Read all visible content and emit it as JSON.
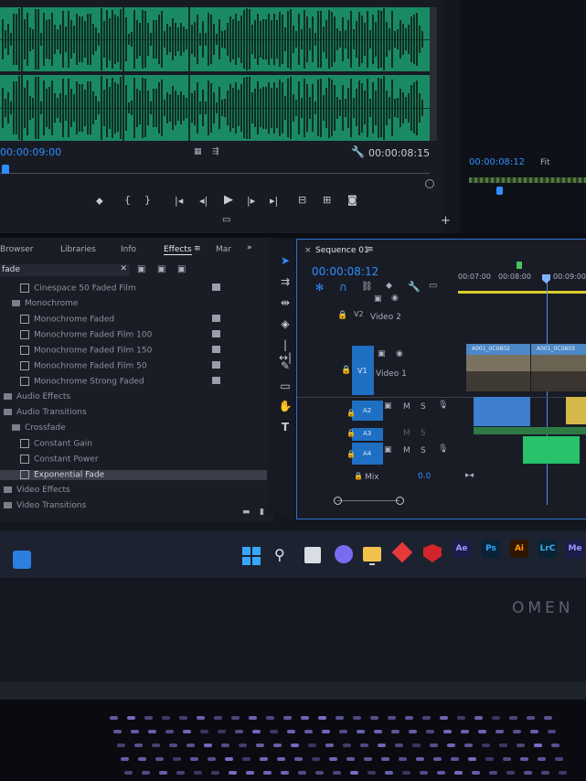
{
  "source_monitor": {
    "timecode_left": "00:00:09:00",
    "timecode_right": "00:00:08:15"
  },
  "program_monitor": {
    "timecode": "00:00:08:12",
    "fit_label": "Fit"
  },
  "effects_panel": {
    "tabs": [
      "Browser",
      "Libraries",
      "Info",
      "Effects",
      "Mar"
    ],
    "search_value": "fade",
    "tree": [
      {
        "label": "Cinespace 50 Faded Film",
        "kind": "preset",
        "level": 2
      },
      {
        "label": "Monochrome",
        "kind": "folder",
        "level": 1
      },
      {
        "label": "Monochrome Faded",
        "kind": "preset",
        "level": 2
      },
      {
        "label": "Monochrome Faded Film 100",
        "kind": "preset",
        "level": 2
      },
      {
        "label": "Monochrome Faded Film 150",
        "kind": "preset",
        "level": 2
      },
      {
        "label": "Monochrome Faded Film 50",
        "kind": "preset",
        "level": 2
      },
      {
        "label": "Monochrome Strong Faded",
        "kind": "preset",
        "level": 2
      },
      {
        "label": "Audio Effects",
        "kind": "folder",
        "level": 0
      },
      {
        "label": "Audio Transitions",
        "kind": "folder",
        "level": 0
      },
      {
        "label": "Crossfade",
        "kind": "folder",
        "level": 1
      },
      {
        "label": "Constant Gain",
        "kind": "effect",
        "level": 2
      },
      {
        "label": "Constant Power",
        "kind": "effect",
        "level": 2
      },
      {
        "label": "Exponential Fade",
        "kind": "effect",
        "level": 2,
        "selected": true
      },
      {
        "label": "Video Effects",
        "kind": "folder",
        "level": 0
      },
      {
        "label": "Video Transitions",
        "kind": "folder",
        "level": 0
      }
    ]
  },
  "timeline": {
    "tab_title": "Sequence 01",
    "timecode": "00:00:08:12",
    "ruler": [
      "00:07:00",
      "00:08:00",
      "00:09:00"
    ],
    "tracks": {
      "v2_id": "V2",
      "v2_name": "Video 2",
      "v1_id": "V1",
      "v1_name": "Video 1",
      "a2_id": "A2",
      "a3_id": "A3",
      "a4_id": "A4",
      "mix_label": "Mix",
      "mix_value": "0.0",
      "mute": "M",
      "solo": "S"
    },
    "clip_labels": [
      "A001_0C0802",
      "A001_0C0803"
    ]
  },
  "taskbar": {
    "apps": [
      "Ae",
      "Ps",
      "Ai",
      "LrC",
      "Me"
    ]
  },
  "laptop": {
    "brand": "OMEN"
  },
  "colors": {
    "waveform": "#1a8a63",
    "accent_blue": "#2f8fff",
    "track_blue": "#1f6fc2",
    "audio_green": "#27c26a"
  }
}
